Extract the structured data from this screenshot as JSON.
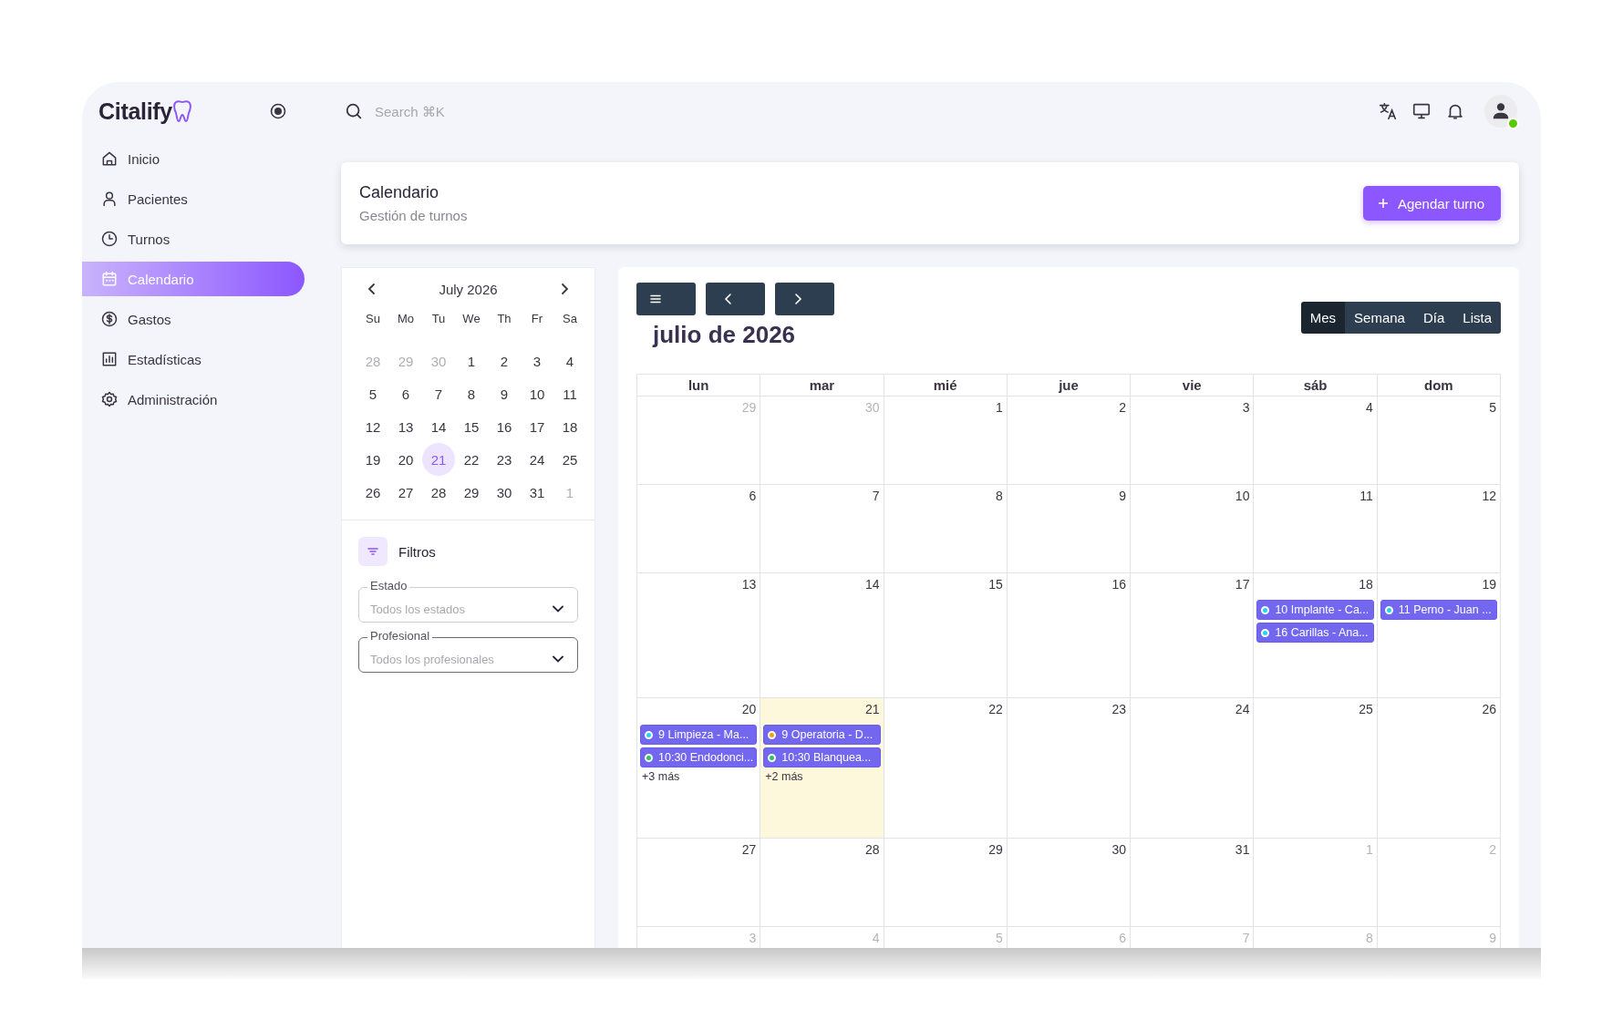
{
  "sidebar": {
    "logo": "Citalify",
    "items": [
      {
        "label": "Inicio",
        "kind": "home",
        "selected": false
      },
      {
        "label": "Pacientes",
        "kind": "user",
        "selected": false
      },
      {
        "label": "Turnos",
        "kind": "clock",
        "selected": false
      },
      {
        "label": "Calendario",
        "kind": "calendar",
        "selected": true
      },
      {
        "label": "Gastos",
        "kind": "dollar",
        "selected": false
      },
      {
        "label": "Estadísticas",
        "kind": "chart",
        "selected": false
      },
      {
        "label": "Administración",
        "kind": "gear",
        "selected": false
      }
    ]
  },
  "topbar": {
    "search": {
      "placeholder": "Search ⌘K"
    }
  },
  "page_header": {
    "title": "Calendario",
    "subtitle": "Gestión de turnos",
    "action": "Agendar turno"
  },
  "mini_calendar": {
    "title": "July 2026",
    "weekdays": [
      "Su",
      "Mo",
      "Tu",
      "We",
      "Th",
      "Fr",
      "Sa"
    ],
    "days": [
      {
        "day": "28",
        "muted": true,
        "selected": false
      },
      {
        "day": "29",
        "muted": true,
        "selected": false
      },
      {
        "day": "30",
        "muted": true,
        "selected": false
      },
      {
        "day": "1",
        "muted": false,
        "selected": false
      },
      {
        "day": "2",
        "muted": false,
        "selected": false
      },
      {
        "day": "3",
        "muted": false,
        "selected": false
      },
      {
        "day": "4",
        "muted": false,
        "selected": false
      },
      {
        "day": "5",
        "muted": false,
        "selected": false
      },
      {
        "day": "6",
        "muted": false,
        "selected": false
      },
      {
        "day": "7",
        "muted": false,
        "selected": false
      },
      {
        "day": "8",
        "muted": false,
        "selected": false
      },
      {
        "day": "9",
        "muted": false,
        "selected": false
      },
      {
        "day": "10",
        "muted": false,
        "selected": false
      },
      {
        "day": "11",
        "muted": false,
        "selected": false
      },
      {
        "day": "12",
        "muted": false,
        "selected": false
      },
      {
        "day": "13",
        "muted": false,
        "selected": false
      },
      {
        "day": "14",
        "muted": false,
        "selected": false
      },
      {
        "day": "15",
        "muted": false,
        "selected": false
      },
      {
        "day": "16",
        "muted": false,
        "selected": false
      },
      {
        "day": "17",
        "muted": false,
        "selected": false
      },
      {
        "day": "18",
        "muted": false,
        "selected": false
      },
      {
        "day": "19",
        "muted": false,
        "selected": false
      },
      {
        "day": "20",
        "muted": false,
        "selected": false
      },
      {
        "day": "21",
        "muted": false,
        "selected": true
      },
      {
        "day": "22",
        "muted": false,
        "selected": false
      },
      {
        "day": "23",
        "muted": false,
        "selected": false
      },
      {
        "day": "24",
        "muted": false,
        "selected": false
      },
      {
        "day": "25",
        "muted": false,
        "selected": false
      },
      {
        "day": "26",
        "muted": false,
        "selected": false
      },
      {
        "day": "27",
        "muted": false,
        "selected": false
      },
      {
        "day": "28",
        "muted": false,
        "selected": false
      },
      {
        "day": "29",
        "muted": false,
        "selected": false
      },
      {
        "day": "30",
        "muted": false,
        "selected": false
      },
      {
        "day": "31",
        "muted": false,
        "selected": false
      },
      {
        "day": "1",
        "muted": true,
        "selected": false
      }
    ]
  },
  "filters": {
    "title": "Filtros",
    "fields": [
      {
        "label": "Estado",
        "placeholder": "Todos los estados"
      },
      {
        "label": "Profesional",
        "placeholder": "Todos los profesionales"
      }
    ]
  },
  "calendar": {
    "title": "julio de 2026",
    "views": [
      {
        "label": "Mes",
        "selected": true
      },
      {
        "label": "Semana",
        "selected": false
      },
      {
        "label": "Día",
        "selected": false
      },
      {
        "label": "Lista",
        "selected": false
      }
    ],
    "weekdays": [
      "lun",
      "mar",
      "mié",
      "jue",
      "vie",
      "sáb",
      "dom"
    ],
    "weeks": [
      {
        "days": [
          {
            "day": "29",
            "muted": true,
            "today": false
          },
          {
            "day": "30",
            "muted": true,
            "today": false
          },
          {
            "day": "1",
            "muted": false,
            "today": false
          },
          {
            "day": "2",
            "muted": false,
            "today": false
          },
          {
            "day": "3",
            "muted": false,
            "today": false
          },
          {
            "day": "4",
            "muted": false,
            "today": false
          },
          {
            "day": "5",
            "muted": false,
            "today": false
          }
        ]
      },
      {
        "days": [
          {
            "day": "6",
            "muted": false,
            "today": false
          },
          {
            "day": "7",
            "muted": false,
            "today": false
          },
          {
            "day": "8",
            "muted": false,
            "today": false
          },
          {
            "day": "9",
            "muted": false,
            "today": false
          },
          {
            "day": "10",
            "muted": false,
            "today": false
          },
          {
            "day": "11",
            "muted": false,
            "today": false
          },
          {
            "day": "12",
            "muted": false,
            "today": false
          }
        ]
      },
      {
        "days": [
          {
            "day": "13",
            "muted": false,
            "today": false
          },
          {
            "day": "14",
            "muted": false,
            "today": false
          },
          {
            "day": "15",
            "muted": false,
            "today": false
          },
          {
            "day": "16",
            "muted": false,
            "today": false
          },
          {
            "day": "17",
            "muted": false,
            "today": false
          },
          {
            "day": "18",
            "muted": false,
            "today": false,
            "events": [
              {
                "label": "10 Implante - Ca...",
                "color": "#22d3ee"
              },
              {
                "label": "16 Carillas - Ana...",
                "color": "#22d3ee"
              }
            ]
          },
          {
            "day": "19",
            "muted": false,
            "today": false,
            "events": [
              {
                "label": "11 Perno - Juan ...",
                "color": "#22d3ee"
              }
            ]
          }
        ]
      },
      {
        "days": [
          {
            "day": "20",
            "muted": false,
            "today": false,
            "events": [
              {
                "label": "9 Limpieza - Ma...",
                "color": "#22d3ee"
              },
              {
                "label": "10:30 Endodonci...",
                "color": "#22c55e"
              }
            ],
            "more": "+3 más"
          },
          {
            "day": "21",
            "muted": false,
            "today": true,
            "events": [
              {
                "label": "9 Operatoria - D...",
                "color": "#f59e0b"
              },
              {
                "label": "10:30 Blanquea...",
                "color": "#22c55e"
              }
            ],
            "more": "+2 más"
          },
          {
            "day": "22",
            "muted": false,
            "today": false
          },
          {
            "day": "23",
            "muted": false,
            "today": false
          },
          {
            "day": "24",
            "muted": false,
            "today": false
          },
          {
            "day": "25",
            "muted": false,
            "today": false
          },
          {
            "day": "26",
            "muted": false,
            "today": false
          }
        ]
      },
      {
        "days": [
          {
            "day": "27",
            "muted": false,
            "today": false
          },
          {
            "day": "28",
            "muted": false,
            "today": false
          },
          {
            "day": "29",
            "muted": false,
            "today": false
          },
          {
            "day": "30",
            "muted": false,
            "today": false
          },
          {
            "day": "31",
            "muted": false,
            "today": false
          },
          {
            "day": "1",
            "muted": true,
            "today": false
          },
          {
            "day": "2",
            "muted": true,
            "today": false
          }
        ]
      },
      {
        "days": [
          {
            "day": "3",
            "muted": true,
            "today": false
          },
          {
            "day": "4",
            "muted": true,
            "today": false
          },
          {
            "day": "5",
            "muted": true,
            "today": false
          },
          {
            "day": "6",
            "muted": true,
            "today": false
          },
          {
            "day": "7",
            "muted": true,
            "today": false
          },
          {
            "day": "8",
            "muted": true,
            "today": false
          },
          {
            "day": "9",
            "muted": true,
            "today": false
          }
        ]
      }
    ]
  }
}
